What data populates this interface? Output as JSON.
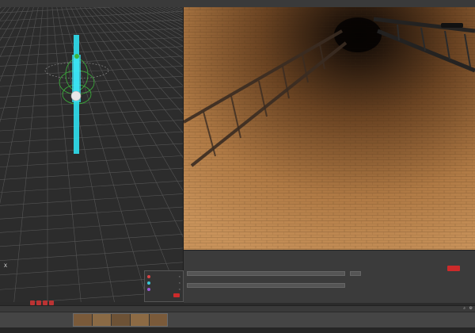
{
  "topbar": {
    "title": "",
    "right": ""
  },
  "viewport3d": {
    "axis_label": "X"
  },
  "legend": {
    "items": [
      {
        "name": "",
        "color": "#d94545"
      },
      {
        "name": "",
        "color": "#3cc8d6"
      },
      {
        "name": "",
        "color": "#9a5bd4"
      }
    ]
  },
  "meta": {
    "label_name": "",
    "label_desc": "",
    "label_tags": "",
    "field1_value": "",
    "field2_value": "",
    "save_label": "",
    "cancel_label": ""
  },
  "timeline": {
    "ticks": [
      "",
      "",
      "",
      "",
      "",
      "",
      "",
      "",
      ""
    ]
  },
  "statusbar": {
    "left_text": "",
    "mid_text": ""
  },
  "colors": {
    "accent": "#cc2a2a",
    "cyan_path": "#2fe0f0",
    "grid_line": "#5a5a5a"
  }
}
